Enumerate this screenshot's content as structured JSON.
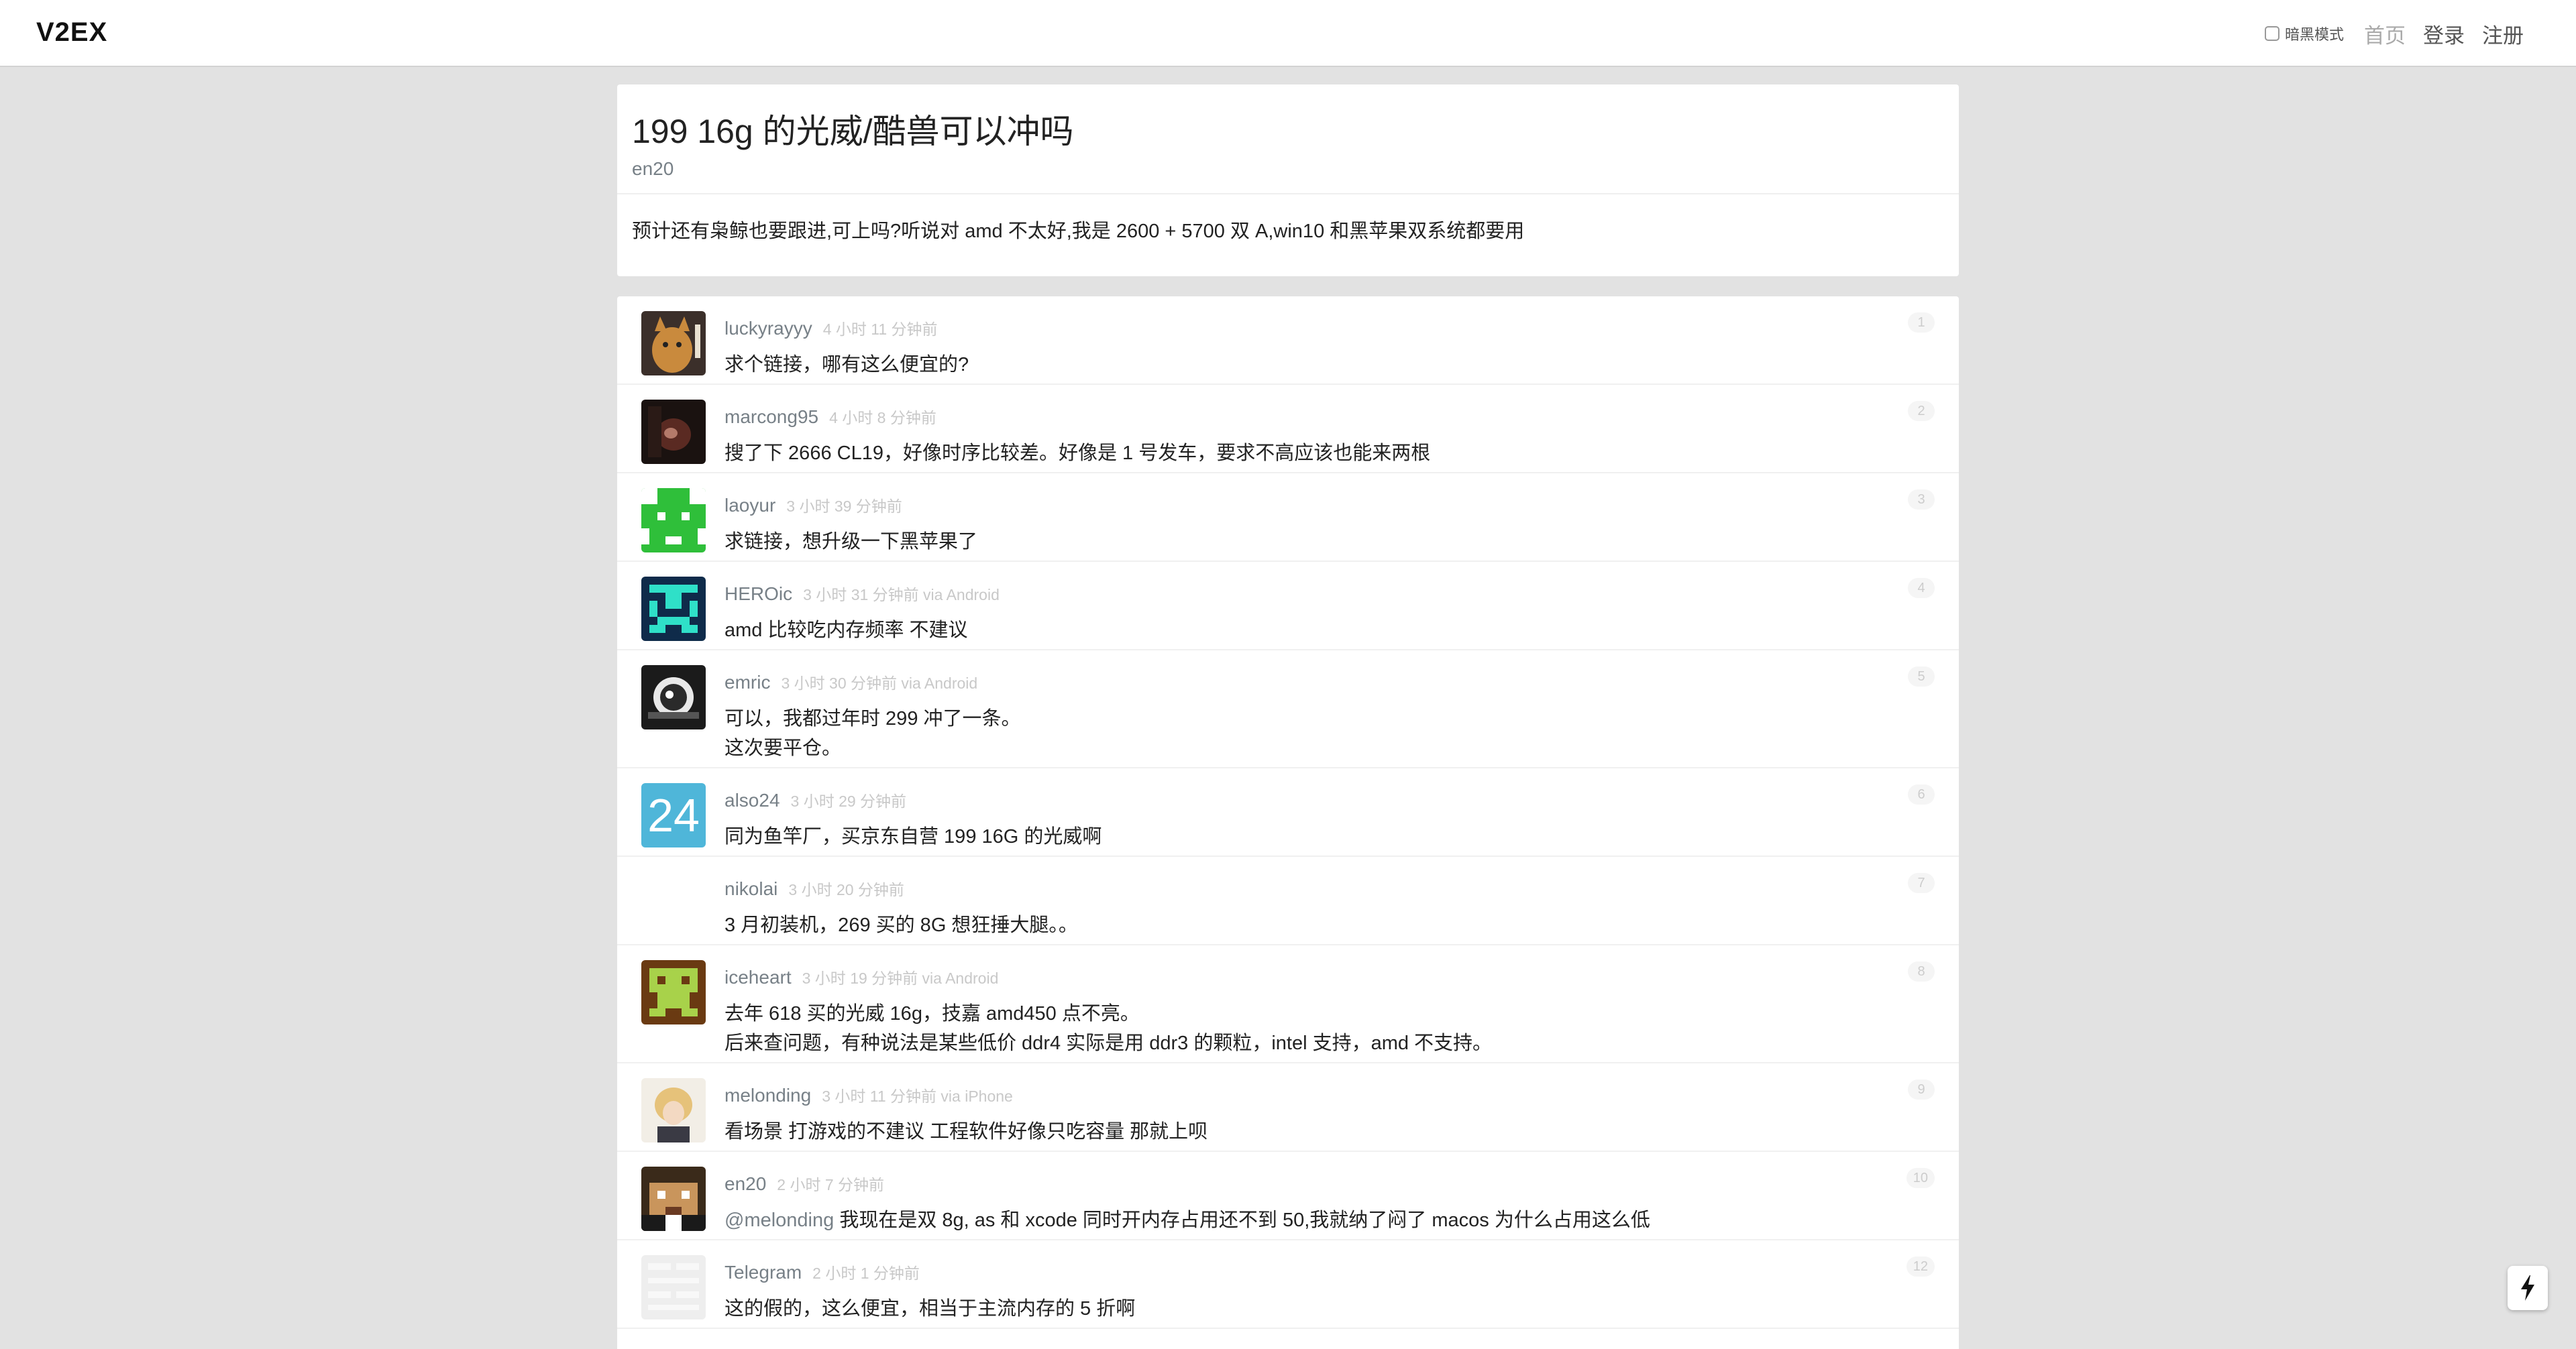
{
  "header": {
    "logo": "V2EX",
    "dark_mode_label": "暗黑模式",
    "nav": {
      "home": "首页",
      "login": "登录",
      "signup": "注册"
    }
  },
  "topic": {
    "title": "199 16g 的光威/酷兽可以冲吗",
    "author": "en20",
    "content": "预计还有枭鲸也要跟进,可上吗?听说对 amd 不太好,我是 2600 + 5700 双 A,win10 和黑苹果双系统都要用"
  },
  "replies": [
    {
      "username": "luckyrayyy",
      "meta": "4 小时 11 分钟前",
      "floor": "1",
      "lines": [
        "求个链接，哪有这么便宜的?"
      ]
    },
    {
      "username": "marcong95",
      "meta": "4 小时 8 分钟前",
      "floor": "2",
      "lines": [
        "搜了下 2666 CL19，好像时序比较差。好像是 1 号发车，要求不高应该也能来两根"
      ]
    },
    {
      "username": "laoyur",
      "meta": "3 小时 39 分钟前",
      "floor": "3",
      "lines": [
        "求链接，想升级一下黑苹果了"
      ]
    },
    {
      "username": "HEROic",
      "meta": "3 小时 31 分钟前 via Android",
      "floor": "4",
      "lines": [
        "amd 比较吃内存频率 不建议"
      ]
    },
    {
      "username": "emric",
      "meta": "3 小时 30 分钟前 via Android",
      "floor": "5",
      "lines": [
        "可以，我都过年时 299 冲了一条。",
        "这次要平仓。"
      ]
    },
    {
      "username": "also24",
      "meta": "3 小时 29 分钟前",
      "floor": "6",
      "lines": [
        "同为鱼竿厂，买京东自营 199 16G 的光威啊"
      ],
      "avatar_text": "24"
    },
    {
      "username": "nikolai",
      "meta": "3 小时 20 分钟前",
      "floor": "7",
      "lines": [
        "3 月初装机，269 买的 8G 想狂捶大腿。。"
      ]
    },
    {
      "username": "iceheart",
      "meta": "3 小时 19 分钟前 via Android",
      "floor": "8",
      "lines": [
        "去年 618 买的光威 16g，技嘉 amd450 点不亮。",
        "后来查问题，有种说法是某些低价 ddr4 实际是用 ddr3 的颗粒，intel 支持，amd 不支持。"
      ]
    },
    {
      "username": "melonding",
      "meta": "3 小时 11 分钟前 via iPhone",
      "floor": "9",
      "lines": [
        "看场景 打游戏的不建议 工程软件好像只吃容量 那就上呗"
      ]
    },
    {
      "username": "en20",
      "meta": "2 小时 7 分钟前",
      "floor": "10",
      "mention": "@melonding",
      "lines": [
        " 我现在是双 8g, as 和 xcode 同时开内存占用还不到 50,我就纳了闷了 macos 为什么占用这么低"
      ]
    },
    {
      "username": "Telegram",
      "meta": "2 小时 1 分钟前",
      "floor": "12",
      "lines": [
        "这的假的，这么便宜，相当于主流内存的 5 折啊"
      ]
    }
  ]
}
